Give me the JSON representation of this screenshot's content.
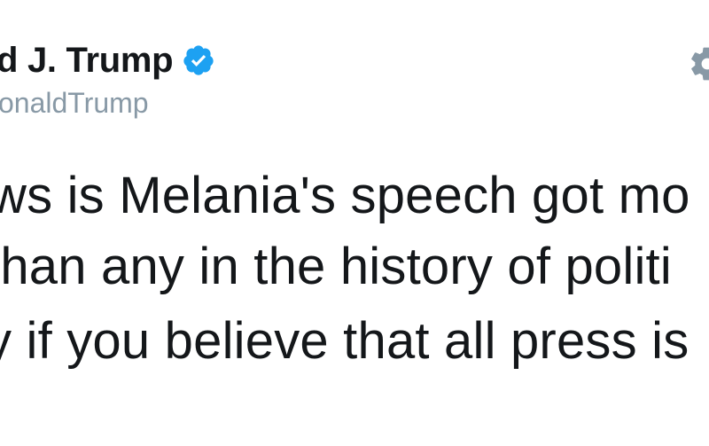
{
  "tweet": {
    "display_name": "d J. Trump",
    "handle": "onaldTrump",
    "verified": true,
    "lines": [
      "ws is Melania's speech got mo",
      "than any in the history of politi",
      "y if you believe that all press is"
    ]
  },
  "icons": {
    "verified": "verified-badge-icon",
    "settings": "gear-icon"
  },
  "colors": {
    "verified_blue": "#1da1f2",
    "text": "#14171a",
    "handle_gray": "#8899a6",
    "gear_gray": "#8899a6"
  }
}
